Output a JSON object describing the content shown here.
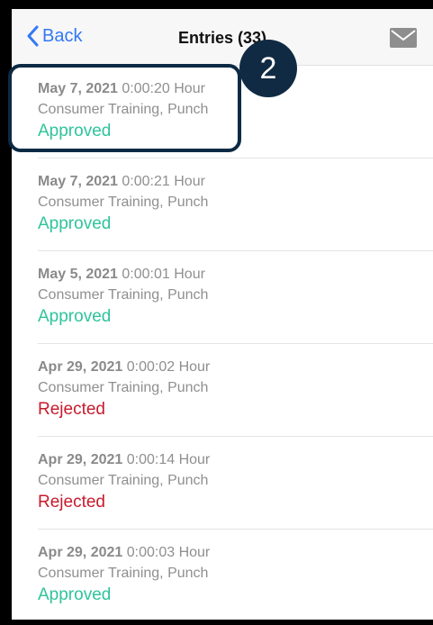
{
  "nav": {
    "back_label": "Back",
    "title": "Entries (33)",
    "icons": {
      "back": "chevron-left-icon",
      "mail": "mail-icon"
    }
  },
  "colors": {
    "accent": "#3478f6",
    "approved": "#2fc49a",
    "rejected": "#c81a2c",
    "badge": "#102a43"
  },
  "badge": {
    "label": "2"
  },
  "entries": [
    {
      "date": "May 7, 2021",
      "duration": "0:00:20 Hour",
      "detail": "Consumer Training, Punch",
      "status": "Approved"
    },
    {
      "date": "May 7, 2021",
      "duration": "0:00:21 Hour",
      "detail": "Consumer Training, Punch",
      "status": "Approved"
    },
    {
      "date": "May 5, 2021",
      "duration": "0:00:01 Hour",
      "detail": "Consumer Training, Punch",
      "status": "Approved"
    },
    {
      "date": "Apr 29, 2021",
      "duration": "0:00:02 Hour",
      "detail": "Consumer Training, Punch",
      "status": "Rejected"
    },
    {
      "date": "Apr 29, 2021",
      "duration": "0:00:14 Hour",
      "detail": "Consumer Training, Punch",
      "status": "Rejected"
    },
    {
      "date": "Apr 29, 2021",
      "duration": "0:00:03 Hour",
      "detail": "Consumer Training, Punch",
      "status": "Approved"
    }
  ]
}
